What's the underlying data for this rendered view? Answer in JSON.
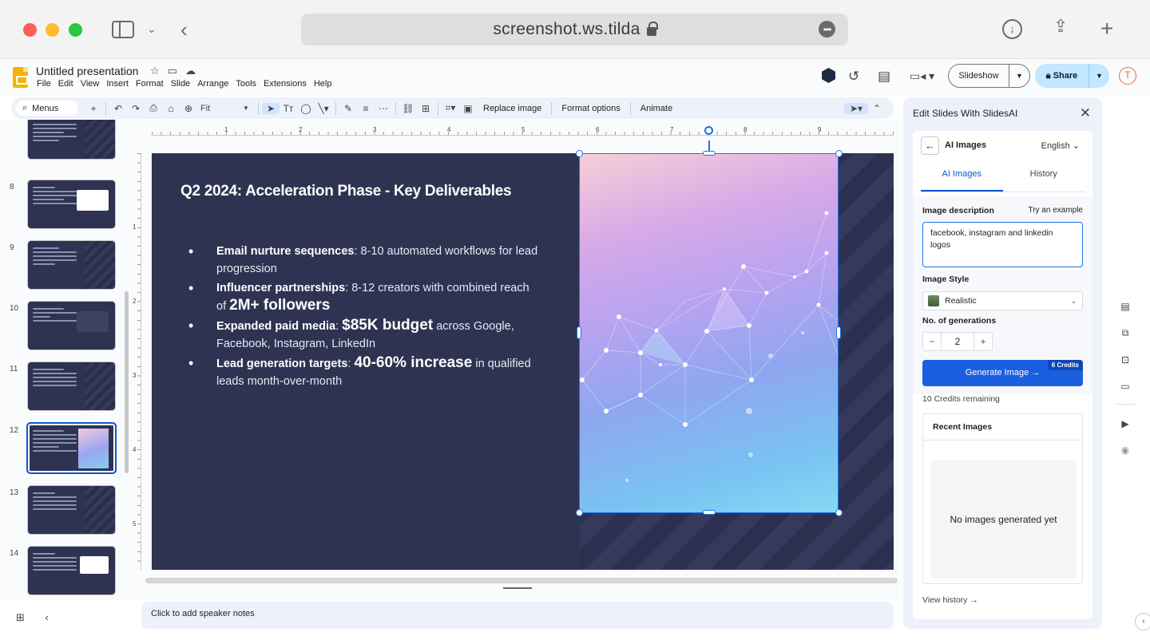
{
  "browser": {
    "url": "screenshot.ws.tilda"
  },
  "app": {
    "title": "Untitled presentation",
    "menu": [
      "File",
      "Edit",
      "View",
      "Insert",
      "Format",
      "Slide",
      "Arrange",
      "Tools",
      "Extensions",
      "Help"
    ],
    "slideshow_label": "Slideshow",
    "share_label": "Share",
    "avatar_letter": "T",
    "colors": {
      "accent": "#0b57d0",
      "share_bg": "#c2e7ff",
      "slides_yellow": "#f4b400",
      "slide_bg": "#2f3352"
    }
  },
  "toolbar": {
    "menus_label": "Menus",
    "zoom_label": "Fit",
    "replace_image": "Replace image",
    "format_options": "Format options",
    "animate": "Animate"
  },
  "filmstrip": {
    "slides": [
      {
        "num": "8"
      },
      {
        "num": "9"
      },
      {
        "num": "10"
      },
      {
        "num": "11"
      },
      {
        "num": "12"
      },
      {
        "num": "13"
      },
      {
        "num": "14"
      }
    ],
    "selected": "12"
  },
  "ruler": {
    "h_labels": [
      "1",
      "2",
      "3",
      "4",
      "5",
      "6",
      "7",
      "8",
      "9"
    ],
    "v_labels": [
      "1",
      "2",
      "3",
      "4",
      "5"
    ]
  },
  "slide": {
    "title": "Q2 2024: Acceleration Phase - Key Deliverables",
    "bullets": [
      {
        "bold": "Email nurture sequences",
        "rest": ": 8-10 automated workflows for lead progression"
      },
      {
        "bold": "Influencer partnerships",
        "rest": ": 8-12 creators with combined reach of ",
        "big": "2M+ followers"
      },
      {
        "bold": "Expanded paid media",
        "rest": ": ",
        "big": "$85K budget",
        "rest2": " across Google, Facebook, Instagram, LinkedIn"
      },
      {
        "bold": "Lead generation targets",
        "rest": ": ",
        "big": "40-60% increase",
        "rest2": " in qualified leads month-over-month"
      }
    ]
  },
  "notes": {
    "placeholder": "Click to add speaker notes"
  },
  "panel": {
    "title": "Edit Slides With SlidesAI",
    "heading": "AI Images",
    "language": "English",
    "tabs": [
      "AI Images",
      "History"
    ],
    "image_description_label": "Image description",
    "try_example": "Try an example",
    "image_description_value": "facebook, instagram and linkedin logos",
    "image_style_label": "Image Style",
    "image_style_value": "Realistic",
    "generations_label": "No. of generations",
    "generations_value": "2",
    "generate_button": "Generate Image →",
    "credits_badge": "6  Credits",
    "credits_remaining": "10 Credits remaining",
    "recent_images_title": "Recent Images",
    "recent_images_empty": "No images generated yet",
    "view_history": "View history →"
  }
}
